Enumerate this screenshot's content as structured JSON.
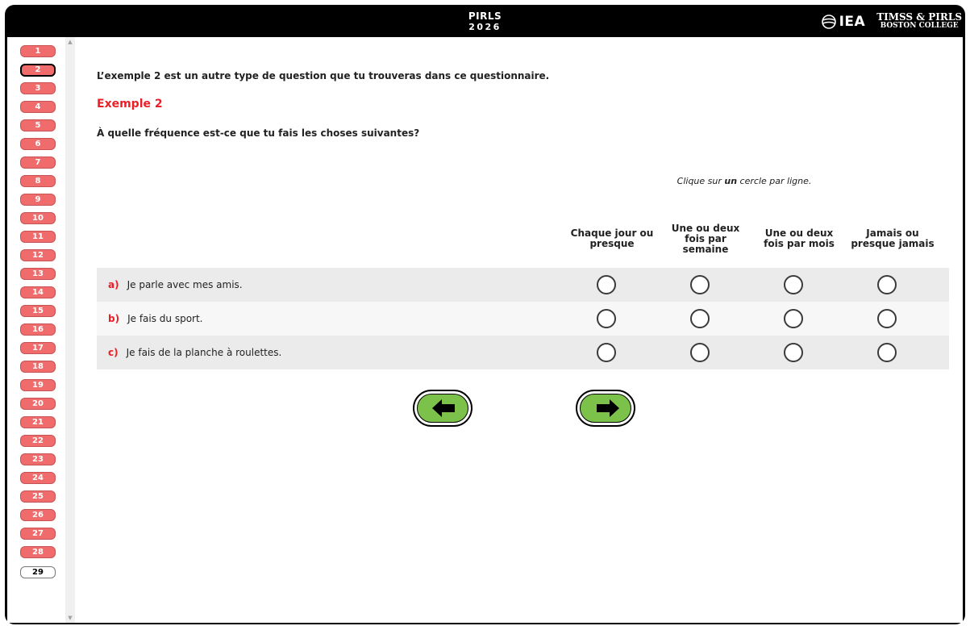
{
  "header": {
    "title": "PIRLS",
    "subtitle": "2026",
    "iea_logo": "IEA",
    "timss_line1": "TIMSS & PIRLS",
    "timss_line2": "BOSTON COLLEGE"
  },
  "sidebar": {
    "items": [
      {
        "label": "1",
        "state": "answered"
      },
      {
        "label": "2",
        "state": "current"
      },
      {
        "label": "3",
        "state": "answered"
      },
      {
        "label": "4",
        "state": "answered"
      },
      {
        "label": "5",
        "state": "answered"
      },
      {
        "label": "6",
        "state": "answered"
      },
      {
        "label": "7",
        "state": "answered"
      },
      {
        "label": "8",
        "state": "answered"
      },
      {
        "label": "9",
        "state": "answered"
      },
      {
        "label": "10",
        "state": "answered"
      },
      {
        "label": "11",
        "state": "answered"
      },
      {
        "label": "12",
        "state": "answered"
      },
      {
        "label": "13",
        "state": "answered"
      },
      {
        "label": "14",
        "state": "answered"
      },
      {
        "label": "15",
        "state": "answered"
      },
      {
        "label": "16",
        "state": "answered"
      },
      {
        "label": "17",
        "state": "answered"
      },
      {
        "label": "18",
        "state": "answered"
      },
      {
        "label": "19",
        "state": "answered"
      },
      {
        "label": "20",
        "state": "answered"
      },
      {
        "label": "21",
        "state": "answered"
      },
      {
        "label": "22",
        "state": "answered"
      },
      {
        "label": "23",
        "state": "answered"
      },
      {
        "label": "24",
        "state": "answered"
      },
      {
        "label": "25",
        "state": "answered"
      },
      {
        "label": "26",
        "state": "answered"
      },
      {
        "label": "27",
        "state": "answered"
      },
      {
        "label": "28",
        "state": "answered"
      },
      {
        "label": "29",
        "state": "pending"
      }
    ]
  },
  "main": {
    "intro": "L’exemple 2 est un autre type de question que tu trouveras dans ce questionnaire.",
    "example_title": "Exemple 2",
    "question": "À quelle fréquence est-ce que tu fais les choses suivantes?",
    "instruction_before": "Clique sur ",
    "instruction_bold": "un",
    "instruction_after": " cercle par ligne.",
    "columns": [
      "Chaque jour ou presque",
      "Une ou deux fois par semaine",
      "Une ou deux fois par mois",
      "Jamais ou presque jamais"
    ],
    "rows": [
      {
        "letter": "a)",
        "text": "Je parle avec mes amis."
      },
      {
        "letter": "b)",
        "text": "Je fais du sport."
      },
      {
        "letter": "c)",
        "text": "Je fais de la planche à roulettes."
      }
    ]
  },
  "navigation": {
    "back_icon": "arrow-left-icon",
    "next_icon": "arrow-right-icon"
  },
  "colors": {
    "accent_red": "#ee1c25",
    "nav_answered": "#f06b6b",
    "nav_button_green": "#7cc24a",
    "row_shade": "#ebebeb"
  }
}
